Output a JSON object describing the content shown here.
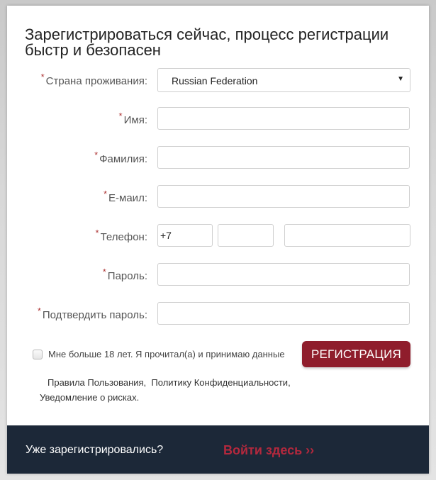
{
  "form": {
    "title": "Зарегистрироваться сейчас, процесс регистрации быстр и безопасен",
    "required_marker": "*",
    "fields": {
      "country": {
        "label": "Страна проживания:",
        "value": "Russian Federation",
        "caret": "▼"
      },
      "first_name": {
        "label": "Имя:",
        "value": ""
      },
      "last_name": {
        "label": "Фамилия:",
        "value": ""
      },
      "email": {
        "label": "Е-маил:",
        "value": ""
      },
      "phone": {
        "label": "Телефон:",
        "country_code": "+7",
        "area_code": "",
        "number": ""
      },
      "password": {
        "label": "Пароль:",
        "value": ""
      },
      "confirm_password": {
        "label": "Подтвердить пароль:",
        "value": ""
      }
    },
    "consent": {
      "checked": false,
      "text": "Мне больше 18 лет. Я прочитал(а) и принимаю данные",
      "terms_link": "Правила Пользования,",
      "privacy_link": "Политику Конфиденциальности,",
      "risk_link": "Уведомление о рисках."
    },
    "submit_label": "РЕГИСТРАЦИЯ"
  },
  "footer": {
    "question": "Уже зарегистрировались?",
    "login_link": "Войти здесь ››"
  },
  "colors": {
    "accent": "#8f1d2c",
    "footer_bg": "#1c2838",
    "link": "#b3283d",
    "required": "#b03a3a"
  }
}
